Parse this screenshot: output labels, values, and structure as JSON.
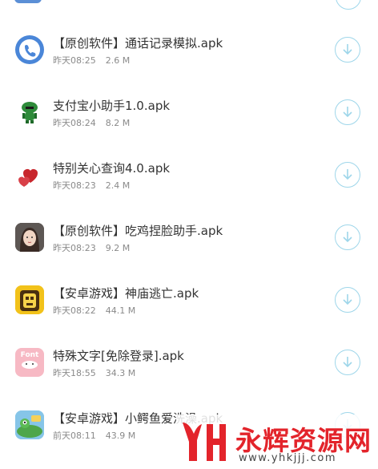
{
  "files": [
    {
      "name": "【原创软件】通话记录模拟.apk",
      "time": "昨天08:25",
      "size": "2.6 M",
      "icon": "phone-call-icon"
    },
    {
      "name": "支付宝小助手1.0.apk",
      "time": "昨天08:24",
      "size": "8.2 M",
      "icon": "green-robot-icon"
    },
    {
      "name": "特别关心查询4.0.apk",
      "time": "昨天08:23",
      "size": "2.4 M",
      "icon": "hearts-icon"
    },
    {
      "name": "【原创软件】吃鸡捏脸助手.apk",
      "time": "昨天08:23",
      "size": "9.2 M",
      "icon": "avatar-face-icon"
    },
    {
      "name": "【安卓游戏】神庙逃亡.apk",
      "time": "昨天08:22",
      "size": "44.1 M",
      "icon": "temple-run-icon"
    },
    {
      "name": "特殊文字[免除登录].apk",
      "time": "昨天18:55",
      "size": "34.3 M",
      "icon": "font-app-icon"
    },
    {
      "name": "【安卓游戏】小鳄鱼爱洗澡.apk",
      "time": "前天08:11",
      "size": "43.9 M",
      "icon": "crocodile-game-icon"
    }
  ],
  "font_icon_text": "Font",
  "download_icon": "download-arrow-icon",
  "watermark": {
    "title": "永辉资源网",
    "url": "www.yhkjjj.com"
  },
  "colors": {
    "accent": "#9ed6ea",
    "text": "#333333",
    "meta": "#8a8a8a",
    "watermark": "#e3242b"
  }
}
